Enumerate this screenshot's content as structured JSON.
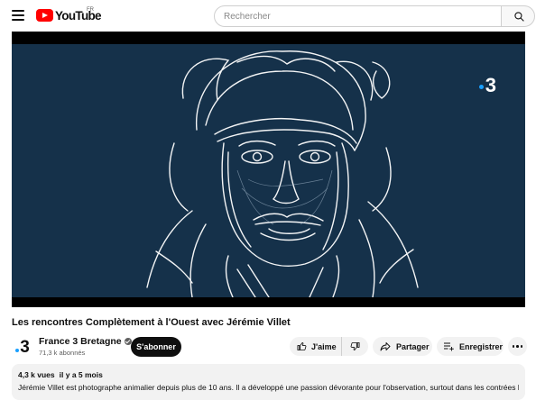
{
  "header": {
    "logo_text": "YouTube",
    "region_code": "FR",
    "search_placeholder": "Rechercher",
    "icons": [
      "menu-icon",
      "youtube-logo-icon",
      "search-icon"
    ]
  },
  "player": {
    "overlay_logo_text": "3",
    "colors": {
      "video_background": "#15314a",
      "logo_dot": "#1aa0ff"
    }
  },
  "video": {
    "title": "Les rencontres Complètement à l'Ouest avec Jérémie Villet"
  },
  "channel": {
    "logo_text": "3",
    "name": "France 3 Bretagne",
    "subscribers": "71,3 k abonnés",
    "subscribe_label": "S'abonner"
  },
  "actions": {
    "like_label": "J'aime",
    "share_label": "Partager",
    "save_label": "Enregistrer",
    "icons": [
      "thumbs-up-icon",
      "thumbs-down-icon",
      "share-arrow-icon",
      "add-to-playlist-icon",
      "more-options-icon"
    ]
  },
  "description": {
    "views": "4,3 k vues",
    "age": "il y a 5 mois",
    "text": "Jérémie Villet est photographe animalier depuis plus de 10 ans. Il a développé une passion dévorante pour l'observation, surtout dans les contrées les"
  }
}
